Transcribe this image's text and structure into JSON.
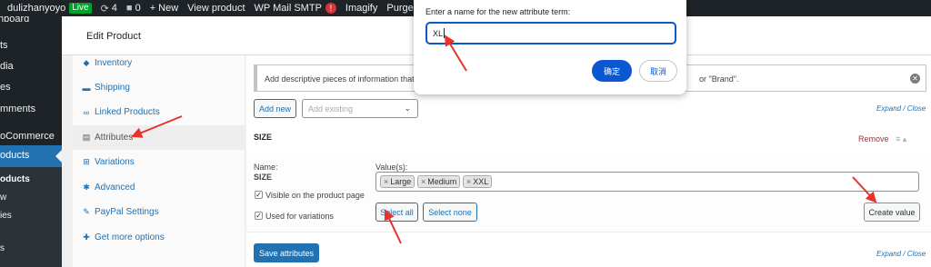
{
  "admin_bar": {
    "site_name": "dulizhanyoyo",
    "live_label": "Live",
    "updates_count": "4",
    "comments_count": "0",
    "new_label": "New",
    "view_product": "View product",
    "mail_smtp": "WP Mail SMTP",
    "mail_notice": "!",
    "imagify": "Imagify",
    "purge_cache": "Purge SG Cache"
  },
  "admin_menu": {
    "items": [
      "hboard",
      "ts",
      "dia",
      "es",
      "mments",
      "oCommerce"
    ],
    "active": "oducts",
    "submenu": [
      "oducts",
      "w",
      "ies",
      "s"
    ]
  },
  "page_title": "Edit Product",
  "tabs": [
    {
      "label": "Inventory",
      "icon": "inventory-icon"
    },
    {
      "label": "Shipping",
      "icon": "truck-icon"
    },
    {
      "label": "Linked Products",
      "icon": "link-icon"
    },
    {
      "label": "Attributes",
      "icon": "table-icon",
      "active": true
    },
    {
      "label": "Variations",
      "icon": "grid-icon"
    },
    {
      "label": "Advanced",
      "icon": "gear-icon"
    },
    {
      "label": "PayPal Settings",
      "icon": "wrench-icon"
    },
    {
      "label": "Get more options",
      "icon": "plugin-icon"
    }
  ],
  "notice": {
    "text_start": "Add descriptive pieces of information that",
    "text_end": "or \"Brand\"."
  },
  "toolbar": {
    "add_new": "Add new",
    "add_existing_placeholder": "Add existing",
    "expand_close": "Expand / Close"
  },
  "attribute": {
    "name": "SIZE",
    "remove": "Remove",
    "name_label": "Name:",
    "name_value": "SIZE",
    "values_label": "Value(s):",
    "values": [
      "Large",
      "Medium",
      "XXL"
    ],
    "visible_label": "Visible on the product page",
    "variations_label": "Used for variations",
    "select_all": "Select all",
    "select_none": "Select none",
    "create_value": "Create value"
  },
  "footer": {
    "save_attributes": "Save attributes",
    "expand_close": "Expand / Close"
  },
  "dialog": {
    "prompt": "Enter a name for the new attribute term:",
    "input_value": "XL",
    "ok_label": "确定",
    "cancel_label": "取消"
  },
  "colors": {
    "wp_blue": "#2271b1",
    "dialog_blue": "#0b57d0",
    "annotation_red": "#e8322a",
    "remove_red": "#b32d2e"
  }
}
